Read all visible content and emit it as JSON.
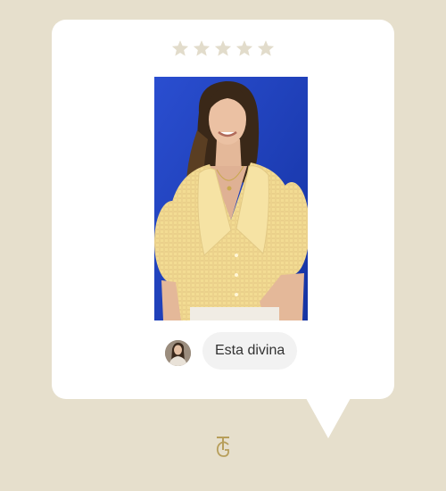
{
  "rating": {
    "value": 0,
    "max": 5,
    "star_color": "#e2dccb",
    "icon": "star-icon"
  },
  "review": {
    "photo": {
      "background_color": "#1d3fb8",
      "shirt_color": "#f2d98e"
    },
    "comment_text": "Esta divina",
    "avatar_icon": "user-avatar"
  },
  "brand": {
    "logo_letters": "TG",
    "logo_color": "#b79e5a"
  },
  "colors": {
    "page_background": "#e6dfcc",
    "card_background": "#ffffff",
    "bubble_background": "#f2f2f2"
  }
}
